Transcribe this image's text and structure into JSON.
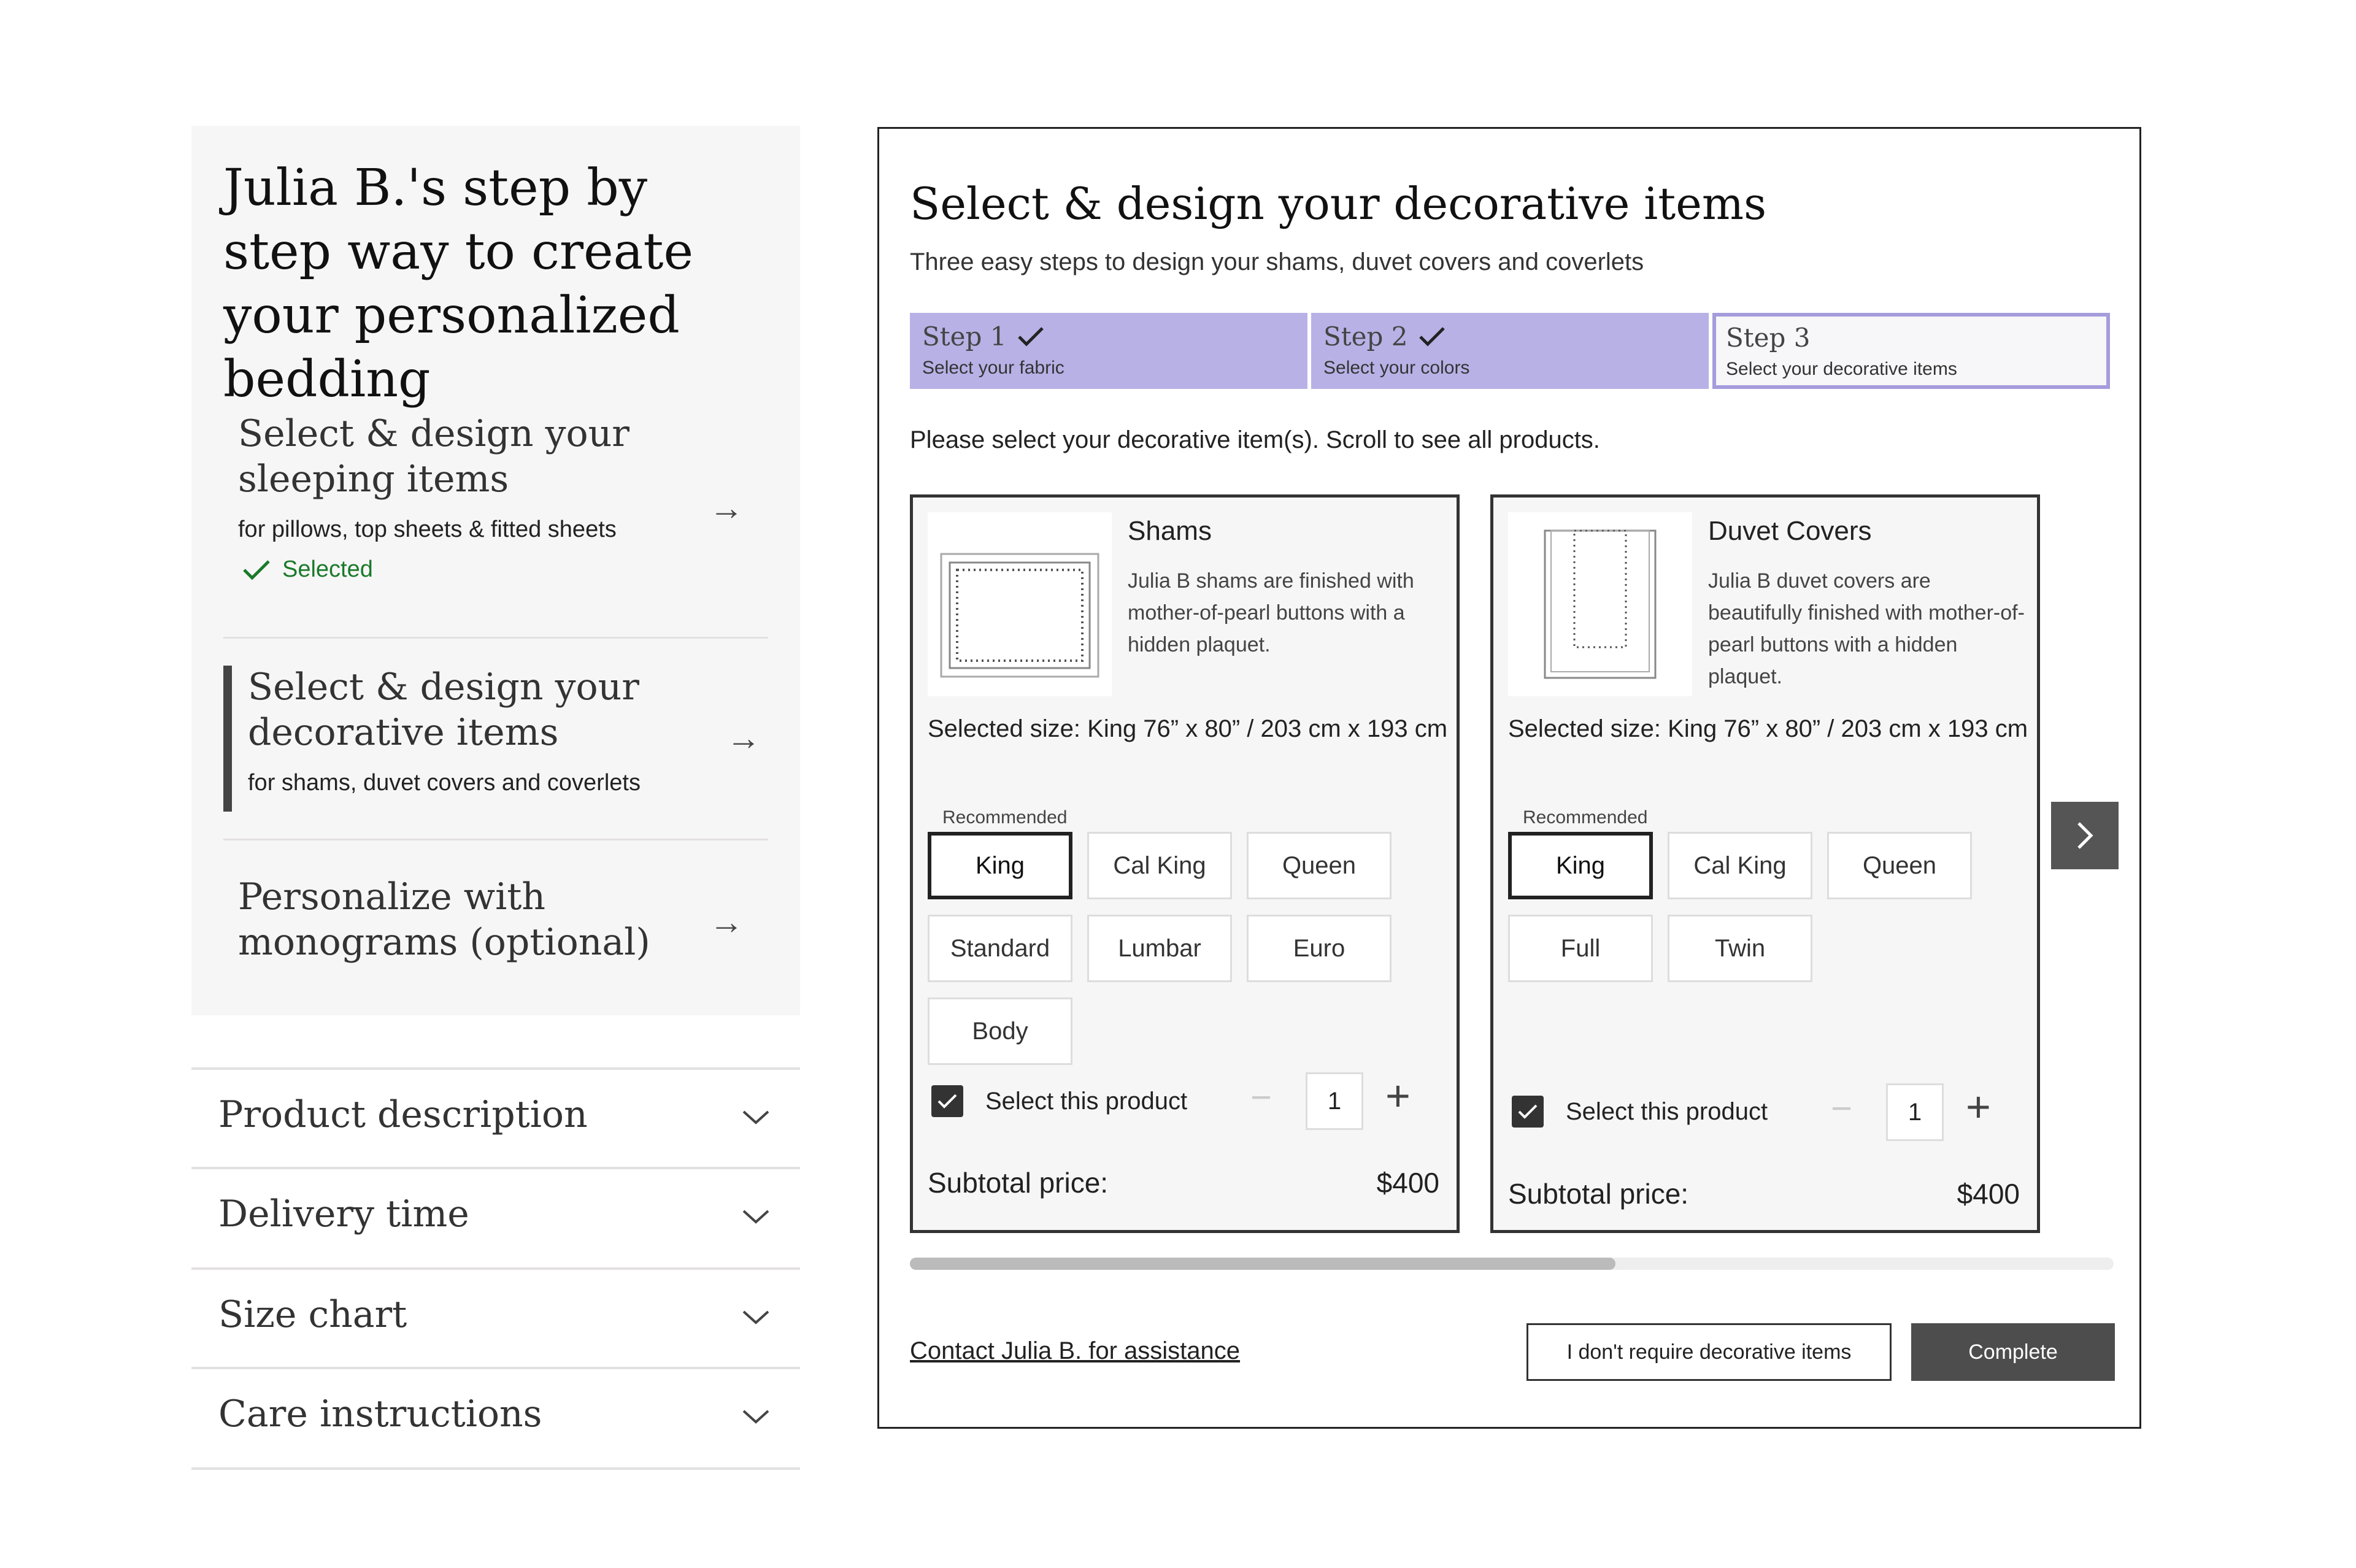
{
  "left": {
    "title": "Julia B.'s step by step way to create your personalized bedding",
    "steps": [
      {
        "title": "Select & design your sleeping items",
        "subtitle": "for pillows, top sheets & fitted sheets",
        "status": "Selected"
      },
      {
        "title": "Select & design your decorative items",
        "subtitle": "for shams, duvet covers and coverlets"
      },
      {
        "title": "Personalize with monograms (optional)"
      }
    ],
    "arrow_glyph": "→",
    "accordions": [
      "Product description",
      "Delivery time",
      "Size chart",
      "Care instructions"
    ]
  },
  "modal": {
    "title": "Select & design your decorative items",
    "subtitle": "Three easy steps to design your shams, duvet covers and coverlets",
    "stepper": [
      {
        "label": "Step 1",
        "desc": "Select your fabric",
        "done": true
      },
      {
        "label": "Step 2",
        "desc": "Select your colors",
        "done": true
      },
      {
        "label": "Step 3",
        "desc": "Select your decorative items",
        "current": true
      }
    ],
    "instruction": "Please select your decorative item(s). Scroll to see all products.",
    "products": [
      {
        "name": "Shams",
        "description": "Julia B shams are finished with mother-of-pearl buttons with a hidden plaquet.",
        "selected_size": "Selected size: King 76” x 80” / 203 cm x 193 cm",
        "recommended": "Recommended",
        "sizes": [
          "King",
          "Cal King",
          "Queen",
          "Standard",
          "Lumbar",
          "Euro",
          "Body"
        ],
        "selected_option": "King",
        "select_label": "Select this product",
        "checked": true,
        "quantity": "1",
        "subtotal_label": "Subtotal price:",
        "subtotal": "$400"
      },
      {
        "name": "Duvet Covers",
        "description": "Julia B duvet covers are beautifully finished with mother-of-pearl buttons with a hidden plaquet.",
        "selected_size": "Selected size: King 76” x 80” / 203 cm x 193 cm",
        "recommended": "Recommended",
        "sizes": [
          "King",
          "Cal King",
          "Queen",
          "Full",
          "Twin"
        ],
        "selected_option": "King",
        "select_label": "Select this product",
        "checked": true,
        "quantity": "1",
        "subtotal_label": "Subtotal price:",
        "subtotal": "$400"
      }
    ],
    "qty_minus": "−",
    "qty_plus": "+",
    "scroll_position": 0.59,
    "contact_link": "Contact Julia B. for assistance",
    "decline_button": "I don't require decorative items",
    "complete_button": "Complete"
  },
  "colors": {
    "step_done": "#b8b1e6",
    "step_current_border": "#a59cdc",
    "selected_green": "#1a7a2a",
    "dark_button": "#4d4d4d"
  }
}
